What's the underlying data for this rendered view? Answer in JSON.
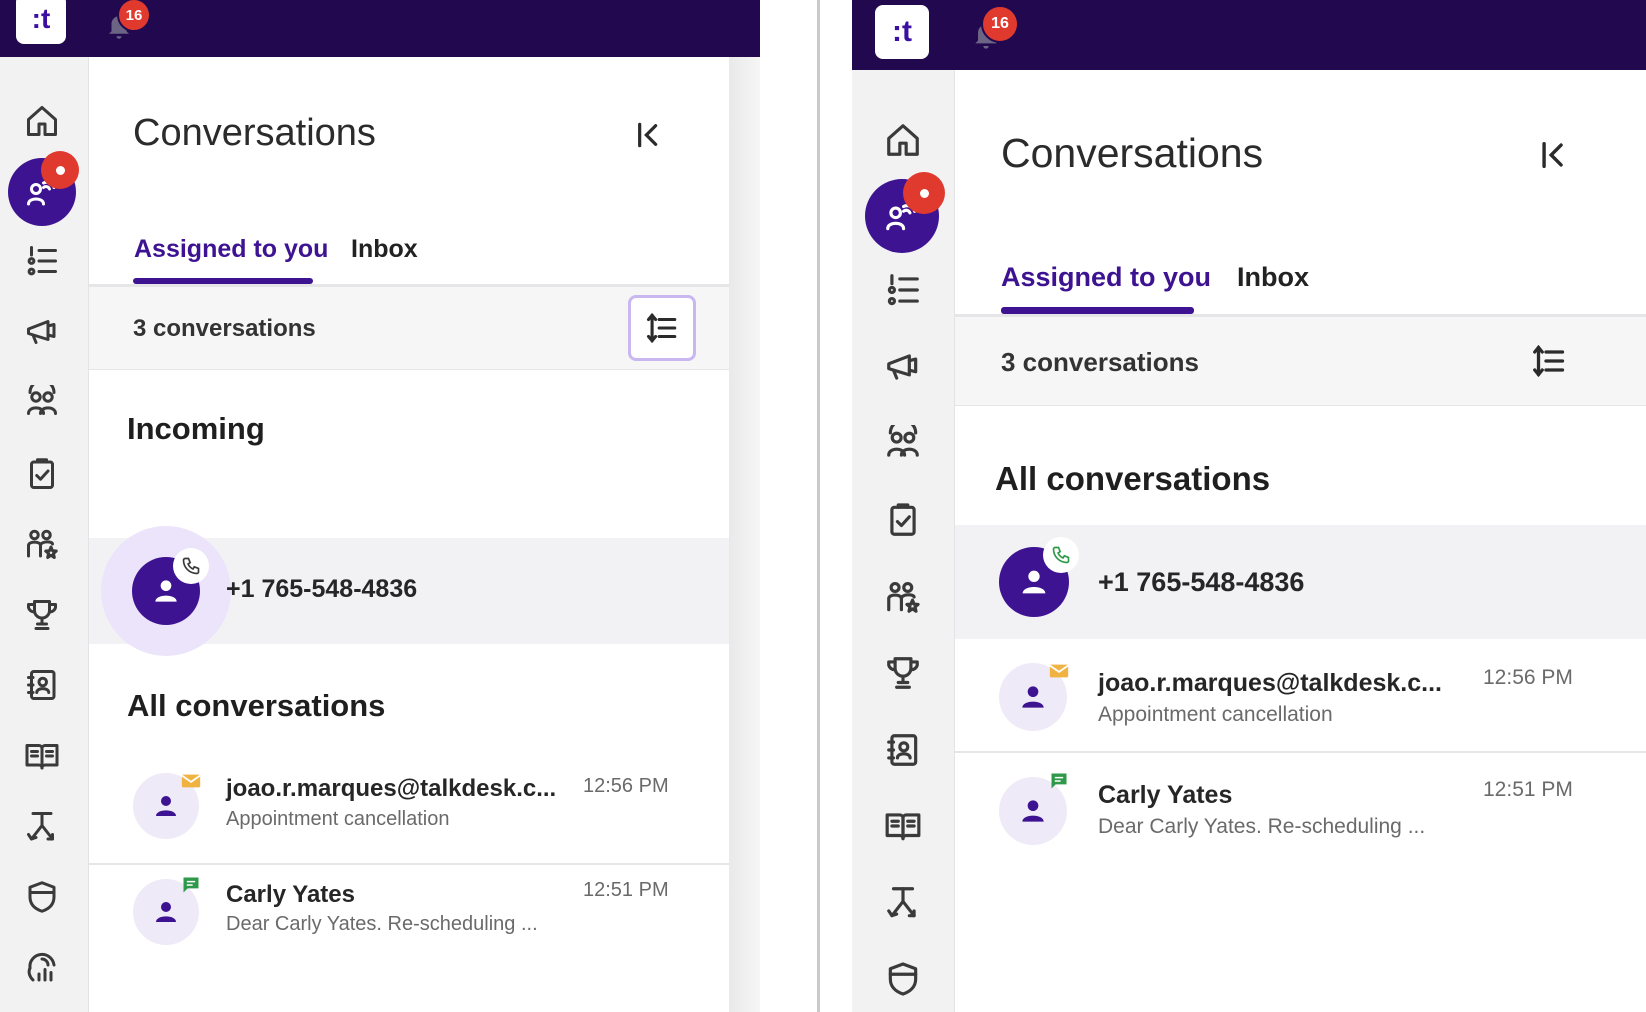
{
  "app": {
    "logo_text": ":t",
    "notification_count": "16"
  },
  "colors": {
    "brand": "#22094f",
    "accent": "#3d1392",
    "badge": "#e03a2e",
    "email": "#f0b341",
    "chat": "#2e9a49"
  },
  "rail_icons": [
    "home-icon",
    "conversations-icon",
    "queue-list-icon",
    "campaign-icon",
    "contacts-group-icon",
    "tasks-icon",
    "team-performance-icon",
    "trophy-icon",
    "directory-icon",
    "knowledge-book-icon",
    "workflow-icon",
    "shield-icon",
    "analytics-icon"
  ],
  "left": {
    "title": "Conversations",
    "tabs": [
      {
        "label": "Assigned to you"
      },
      {
        "label": "Inbox"
      }
    ],
    "count_label": "3 conversations",
    "incoming_header": "Incoming",
    "incoming": {
      "phone": "+1 765-548-4836",
      "channel": "incoming-call-icon"
    },
    "all_header": "All conversations",
    "items": [
      {
        "name": "joao.r.marques@talkdesk.c...",
        "preview": "Appointment cancellation",
        "time": "12:56 PM",
        "channel": "email-icon"
      },
      {
        "name": "Carly Yates",
        "preview": "Dear Carly Yates. Re-scheduling ...",
        "time": "12:51 PM",
        "channel": "chat-icon"
      }
    ]
  },
  "right": {
    "title": "Conversations",
    "tabs": [
      {
        "label": "Assigned to you"
      },
      {
        "label": "Inbox"
      }
    ],
    "count_label": "3 conversations",
    "all_header": "All conversations",
    "active": {
      "phone": "+1 765-548-4836",
      "channel": "active-call-icon"
    },
    "items": [
      {
        "name": "joao.r.marques@talkdesk.c...",
        "preview": "Appointment cancellation",
        "time": "12:56 PM",
        "channel": "email-icon"
      },
      {
        "name": "Carly Yates",
        "preview": "Dear Carly Yates. Re-scheduling ...",
        "time": "12:51 PM",
        "channel": "chat-icon"
      }
    ]
  }
}
